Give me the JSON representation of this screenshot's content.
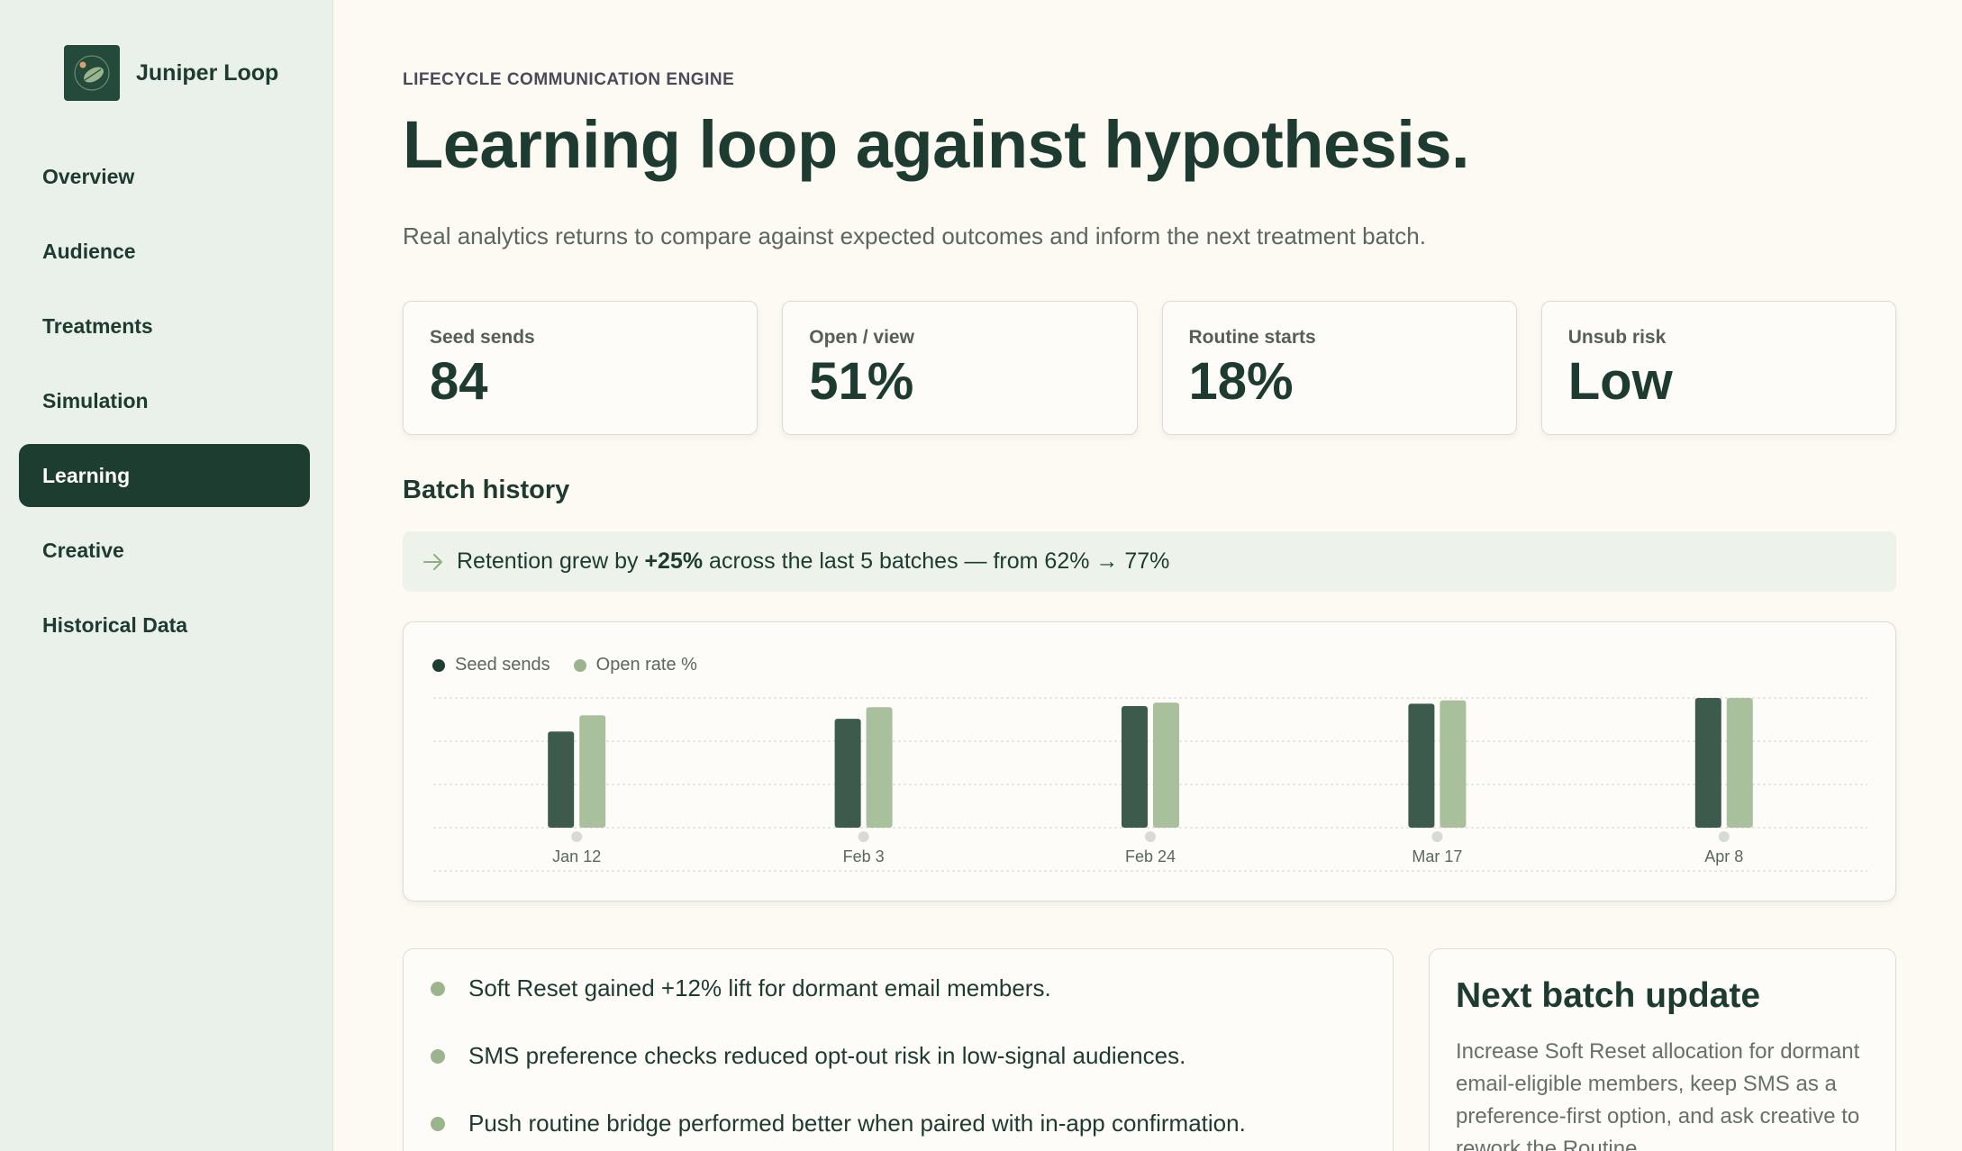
{
  "brand": {
    "name": "Juniper Loop",
    "logo_icon": "leaf-icon"
  },
  "sidebar": {
    "items": [
      {
        "label": "Overview",
        "active": false
      },
      {
        "label": "Audience",
        "active": false
      },
      {
        "label": "Treatments",
        "active": false
      },
      {
        "label": "Simulation",
        "active": false
      },
      {
        "label": "Learning",
        "active": true
      },
      {
        "label": "Creative",
        "active": false
      },
      {
        "label": "Historical Data",
        "active": false
      }
    ]
  },
  "header": {
    "eyebrow": "LIFECYCLE COMMUNICATION ENGINE",
    "title": "Learning loop against hypothesis.",
    "subtitle": "Real analytics returns to compare against expected outcomes and inform the next treatment batch."
  },
  "kpis": [
    {
      "label": "Seed sends",
      "value": "84"
    },
    {
      "label": "Open / view",
      "value": "51%"
    },
    {
      "label": "Routine starts",
      "value": "18%"
    },
    {
      "label": "Unsub risk",
      "value": "Low"
    }
  ],
  "batch_history": {
    "heading": "Batch history",
    "insight": {
      "prefix": "Retention grew by ",
      "highlight": "+25%",
      "suffix": " across the last 5 batches — from 62% → 77%"
    }
  },
  "chart_data": {
    "type": "bar",
    "categories": [
      "Jan 12",
      "Feb 3",
      "Feb 24",
      "Mar 17",
      "Apr 8"
    ],
    "series": [
      {
        "name": "Seed sends",
        "values": [
          83,
          94,
          105,
          107,
          112
        ]
      },
      {
        "name": "Open rate %",
        "values": [
          97,
          104,
          108,
          110,
          112
        ]
      }
    ],
    "ylim": [
      0,
      112
    ],
    "grid": true,
    "legend_position": "top-left",
    "colors": {
      "seed_sends": "#3d5b4c",
      "open_rate": "#a9c09c"
    }
  },
  "learnings": [
    "Soft Reset gained +12% lift for dormant email members.",
    "SMS preference checks reduced opt-out risk in low-signal audiences.",
    "Push routine bridge performed better when paired with in-app confirmation."
  ],
  "next_batch": {
    "title": "Next batch update",
    "body": "Increase Soft Reset allocation for dormant email-eligible members, keep SMS as a preference-first option, and ask creative to rework the Routine"
  },
  "colors": {
    "accent": "#1e3d31",
    "sidebar_bg": "#eaf1ea",
    "page_bg": "#fdf9f3",
    "insight_bg": "#edf2ea"
  }
}
